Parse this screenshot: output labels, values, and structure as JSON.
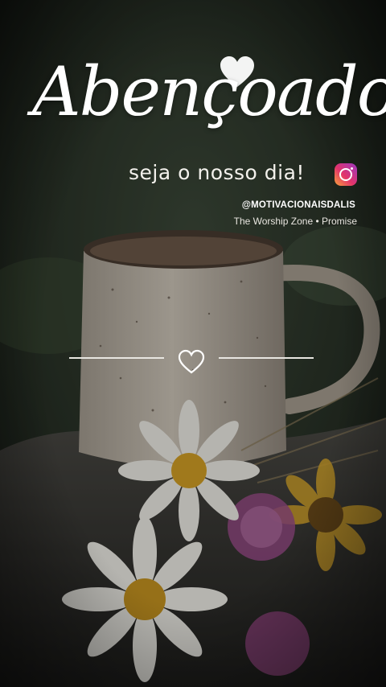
{
  "story": {
    "title": "Abençoado",
    "subtitle": "seja o nosso dia!",
    "handle": "@MOTIVACIONAISDALIS",
    "music": "The Worship Zone • Promise"
  },
  "icons": {
    "heart_top": "heart-icon",
    "heart_center": "heart-outline-icon",
    "instagram": "instagram-icon"
  },
  "colors": {
    "text": "#ffffff",
    "background": "#1e2420",
    "mug": "#c9c1b4"
  }
}
